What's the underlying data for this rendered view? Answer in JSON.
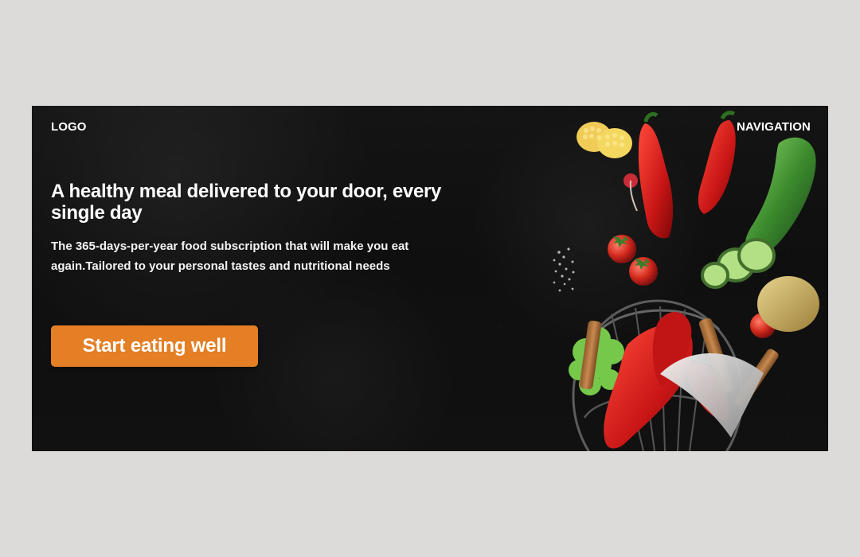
{
  "header": {
    "logo": "LOGO",
    "navigation": "NAVIGATION"
  },
  "hero": {
    "headline": "A healthy meal delivered to your door, every single day",
    "subtext": "The 365-days-per-year food subscription that will make you eat again.Tailored to your personal tastes and nutritional needs",
    "cta_label": "Start eating well"
  },
  "colors": {
    "background": "#dcdbd9",
    "hero_background": "#111111",
    "cta": "#e47f25",
    "text": "#ffffff"
  }
}
